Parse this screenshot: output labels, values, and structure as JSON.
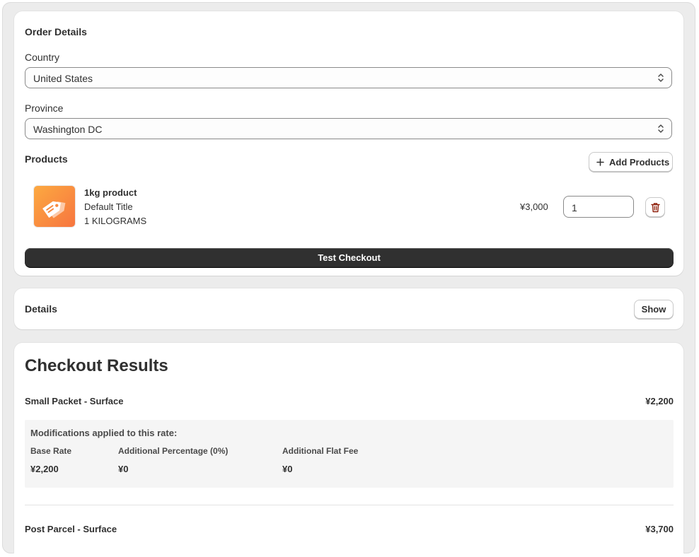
{
  "order_details": {
    "title": "Order Details",
    "country_label": "Country",
    "country_value": "United States",
    "province_label": "Province",
    "province_value": "Washington DC",
    "products_label": "Products",
    "add_products_label": "Add Products",
    "product": {
      "name": "1kg product",
      "variant": "Default Title",
      "weight": "1 KILOGRAMS",
      "price": "¥3,000",
      "quantity": "1"
    },
    "test_checkout_label": "Test Checkout"
  },
  "details": {
    "title": "Details",
    "show_label": "Show"
  },
  "checkout_results": {
    "title": "Checkout Results",
    "rates": [
      {
        "name": "Small Packet - Surface",
        "price": "¥2,200",
        "modifications_title": "Modifications applied to this rate:",
        "columns": [
          {
            "label": "Base Rate",
            "value": "¥2,200"
          },
          {
            "label": "Additional Percentage (0%)",
            "value": "¥0"
          },
          {
            "label": "Additional Flat Fee",
            "value": "¥0"
          }
        ]
      },
      {
        "name": "Post Parcel - Surface",
        "price": "¥3,700"
      }
    ]
  },
  "colors": {
    "primary_button": "#303030",
    "product_thumb_start": "#fca941",
    "product_thumb_end": "#f7753f",
    "delete_icon": "#8e1f0b"
  }
}
